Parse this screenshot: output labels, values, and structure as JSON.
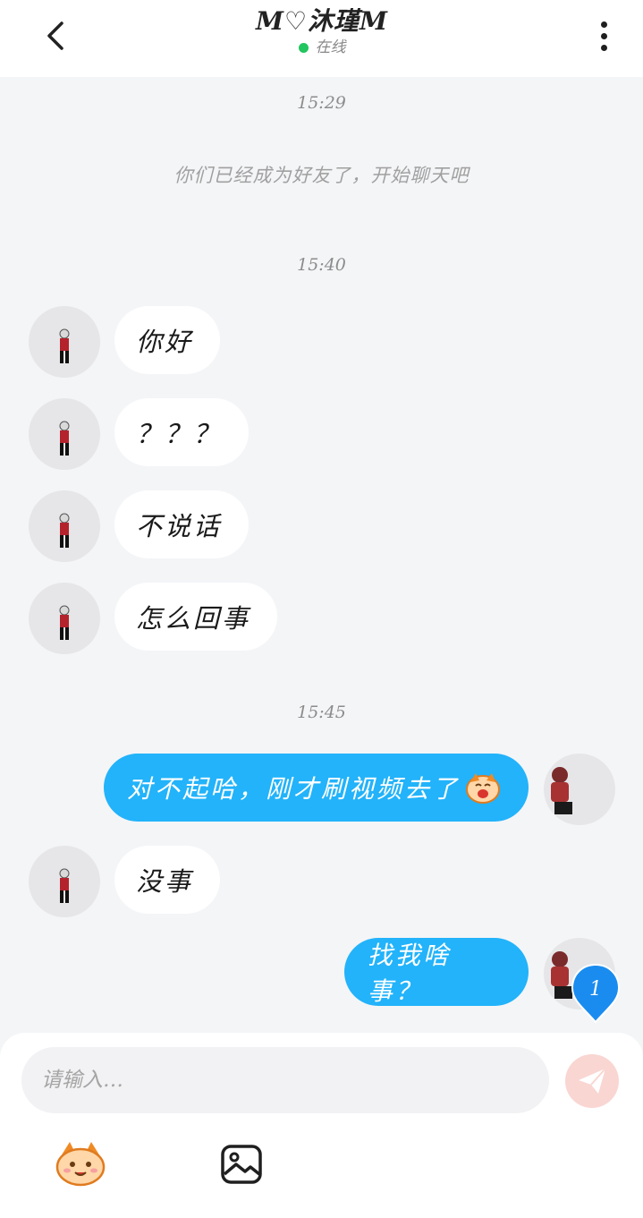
{
  "header": {
    "title": "M♡沐瑾M",
    "status": "在线",
    "status_color": "#22c55e"
  },
  "chat": {
    "welcome": "你们已经成为好友了，开始聊天吧",
    "timestamps": [
      "15:29",
      "15:40",
      "15:45"
    ],
    "messages": [
      {
        "from": "them",
        "text": "你好"
      },
      {
        "from": "them",
        "text": "？？？"
      },
      {
        "from": "them",
        "text": "不说话"
      },
      {
        "from": "them",
        "text": "怎么回事"
      },
      {
        "from": "me",
        "text": "对不起哈，刚才刷视频去了",
        "sticker": "laughing-sticker"
      },
      {
        "from": "them",
        "text": "没事"
      },
      {
        "from": "me",
        "text": "找我啥事？"
      }
    ],
    "badge": "1"
  },
  "composer": {
    "placeholder": "请输入…",
    "icons": [
      "emoji-icon",
      "image-icon",
      "send-icon"
    ],
    "send_color": "#f9d6d2",
    "accent": "#22b3fa"
  }
}
